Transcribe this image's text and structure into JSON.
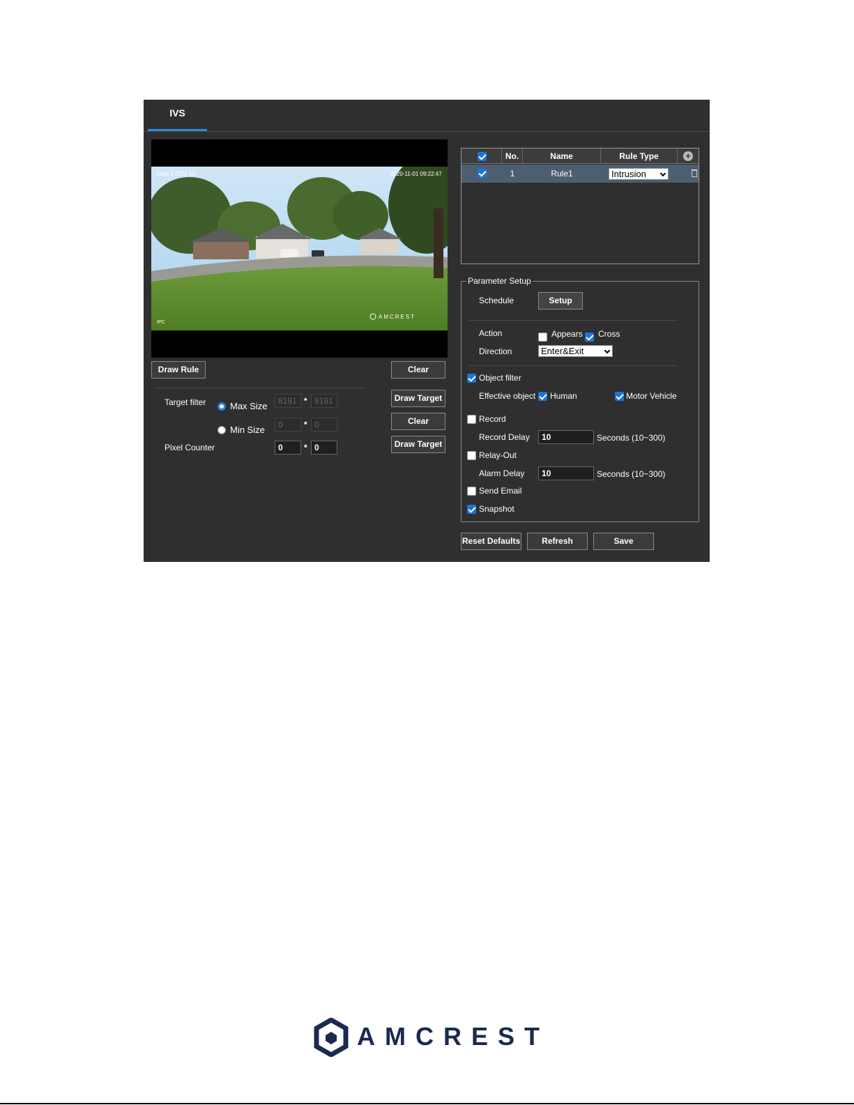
{
  "tab": {
    "label": "IVS"
  },
  "left": {
    "draw_rule": "Draw Rule",
    "clear": "Clear",
    "target_filter": "Target filter",
    "max_size": "Max Size",
    "min_size": "Min Size",
    "max_w": "8191",
    "max_h": "8191",
    "min_w": "0",
    "min_h": "0",
    "star": "*",
    "draw_target": "Draw Target",
    "clear2": "Clear",
    "pixel_counter": "Pixel Counter",
    "px_w": "0",
    "px_h": "0",
    "draw_target2": "Draw Target"
  },
  "video": {
    "osd_left": "Cam 1 2020-12",
    "osd_right": "2020-11-01 09:22:47",
    "watermark": "AMCREST",
    "corner": "IPC"
  },
  "rules": {
    "headers": {
      "no": "No.",
      "name": "Name",
      "type": "Rule Type"
    },
    "rows": [
      {
        "no": "1",
        "name": "Rule1",
        "type": "Intrusion"
      }
    ]
  },
  "params": {
    "legend": "Parameter Setup",
    "schedule": "Schedule",
    "setup": "Setup",
    "action": "Action",
    "appears": "Appears",
    "cross": "Cross",
    "direction": "Direction",
    "direction_value": "Enter&Exit",
    "object_filter": "Object filter",
    "effective_object": "Effective object",
    "human": "Human",
    "motor_vehicle": "Motor Vehicle",
    "record": "Record",
    "record_delay": "Record Delay",
    "record_delay_value": "10",
    "seconds1": "Seconds (10~300)",
    "relay_out": "Relay-Out",
    "alarm_delay": "Alarm Delay",
    "alarm_delay_value": "10",
    "seconds2": "Seconds (10~300)",
    "send_email": "Send Email",
    "snapshot": "Snapshot"
  },
  "footer": {
    "reset": "Reset Defaults",
    "refresh": "Refresh",
    "save": "Save"
  },
  "brand": {
    "name": "AMCREST"
  }
}
